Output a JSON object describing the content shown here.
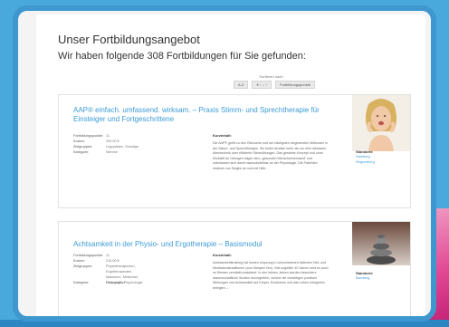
{
  "heading": {
    "title": "Unser Fortbildungsangebot",
    "subtitle": "Wir haben folgende 308 Fortbildungen für Sie gefunden:"
  },
  "sort": {
    "label": "Sortieren nach:",
    "buttons": [
      "A-Z",
      "€ ↑ ↓ ↑",
      "Fortbildungspunkte"
    ]
  },
  "courses": [
    {
      "title": "AAP® einfach. umfassend. wirksam. – Praxis Stimm- und Sprechtherapie für Einsteiger und Fortgeschrittene",
      "fields": [
        {
          "key": "Fortbildungspunkte:",
          "value": "11"
        },
        {
          "key": "Kosten:",
          "value": "290,00 €"
        },
        {
          "key": "Zielgruppen:",
          "value": "Logopäden, Sonstige"
        },
        {
          "key": "Kategorie:",
          "value": "Stimme"
        }
      ],
      "desc_label": "Kurzinhalt:",
      "description": "Die AAP® greift zu den Ökonomie und am häufigsten eingesetzten Methoden in der Stimm- und Sprechtherapie. Sie bietet deutlich mehr als nur eine wirksame Atemtechnik oder effiziente Stimmübungen. Das gesamte Konzept und ohne Klickstift an Übungen folgen dem „gesunden Menschenverstand“ und unterlassen sich damit nachvollziehbar an der Physiologie. Die Patienten erfahren von Beginn an und mit Hilfe...",
      "standort_label": "Standorte",
      "standorte": [
        "Hamburg",
        "Regensburg"
      ]
    },
    {
      "title": "Achtsamkeit in der Physio- und Ergotherapie – Basismodul",
      "fields": [
        {
          "key": "Fortbildungspunkte:",
          "value": "11"
        },
        {
          "key": "Kosten:",
          "value": "210,00 €"
        },
        {
          "key": "Zielgruppen:",
          "value": "Physiotherapeuten, Ergotherapeuten, Masseure, Mediziner, Heilpraktiker"
        },
        {
          "key": "Kategorie:",
          "value": "Pädagogik, Psychologie"
        }
      ],
      "desc_label": "Kurzinhalt:",
      "description": "Achtsamkeitstraining hat seinen Ursprung in verschiedenen östlichen Heil- und Meditationstraditionen (zum Beispiel Zen). Seit ungefähr 40 Jahren wird es auch im Westen verstärkt praktiziert. In den letzten Jahren wurden besonders wissenschaftliche Studien durchgeführt, welche die vielseitigen positiven Wirkungen von Achtsamkeit auf Körper, Emotionen und das Leben erfolgreich belegten....",
      "standort_label": "Standorte",
      "standorte": [
        "Bamberg"
      ]
    }
  ],
  "colors": {
    "background": "#4aa9dc",
    "link": "#3d9bd6",
    "accent_pink": "#e24a95"
  }
}
